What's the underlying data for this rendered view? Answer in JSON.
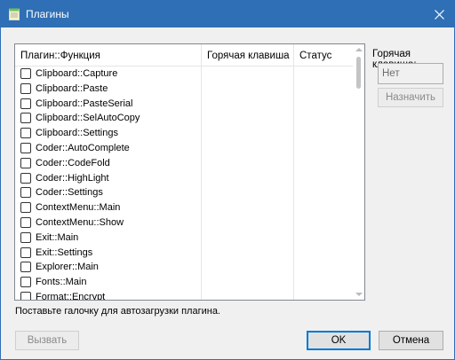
{
  "window": {
    "title": "Плагины"
  },
  "list": {
    "columns": [
      "Плагин::Функция",
      "Горячая клавиша",
      "Статус"
    ],
    "rows": [
      "Clipboard::Capture",
      "Clipboard::Paste",
      "Clipboard::PasteSerial",
      "Clipboard::SelAutoCopy",
      "Clipboard::Settings",
      "Coder::AutoComplete",
      "Coder::CodeFold",
      "Coder::HighLight",
      "Coder::Settings",
      "ContextMenu::Main",
      "ContextMenu::Show",
      "Exit::Main",
      "Exit::Settings",
      "Explorer::Main",
      "Fonts::Main",
      "Format::Encrypt"
    ]
  },
  "sidebar": {
    "hotkey_label": "Горячая клавиша:",
    "hotkey_value": "Нет",
    "assign_label": "Назначить"
  },
  "hint": "Поставьте галочку для автозагрузки плагина.",
  "buttons": {
    "call": "Вызвать",
    "ok": "OK",
    "cancel": "Отмена"
  },
  "colors": {
    "titlebar": "#2f6fb5",
    "accent": "#0078d7"
  }
}
